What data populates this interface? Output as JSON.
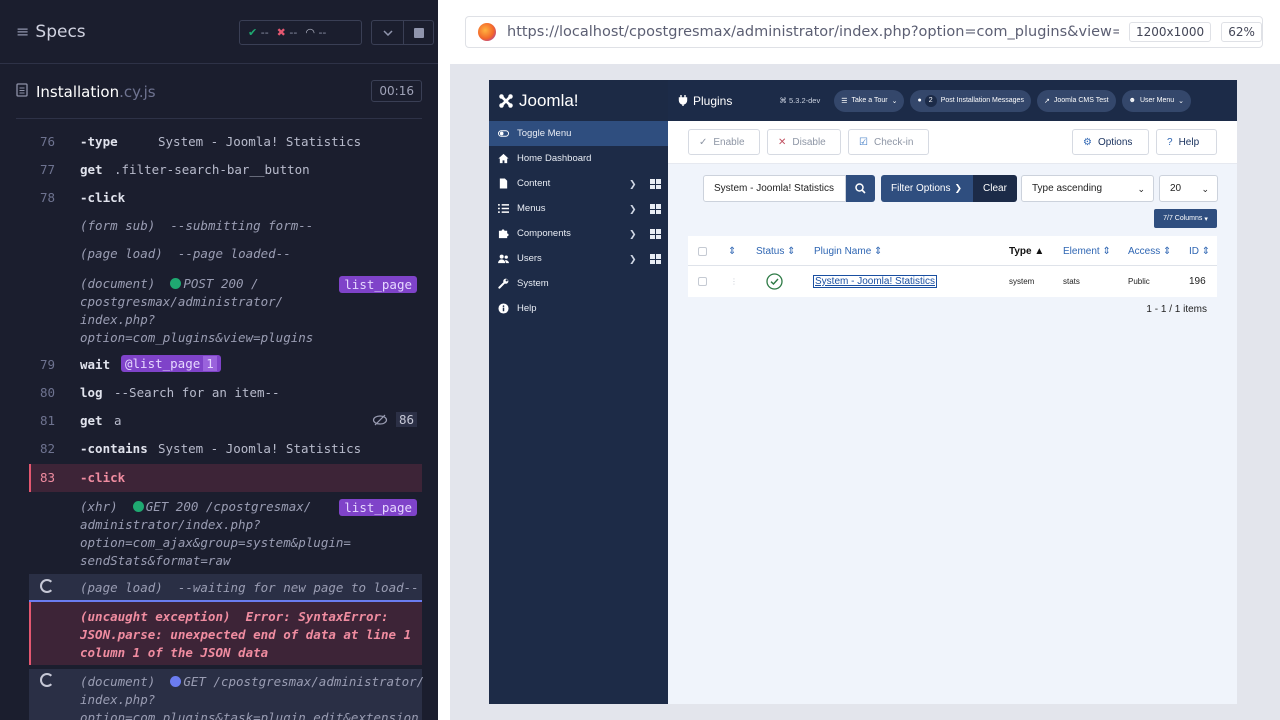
{
  "runner": {
    "specs_title": "Specs",
    "stats": {
      "passed": "--",
      "failed": "--",
      "pending": "--"
    },
    "file_name": "Installation",
    "file_ext": ".cy.js",
    "timer": "00:16",
    "commands": [
      {
        "num": "76",
        "name": "-type",
        "message": "System - Joomla! Statistics"
      },
      {
        "num": "77",
        "name": "get",
        "message": ".filter-search-bar__button"
      },
      {
        "num": "78",
        "name": "-click",
        "message": ""
      },
      {
        "sub": "(form sub)",
        "message": "--submitting form--"
      },
      {
        "sub": "(page load)",
        "message": "--page loaded--"
      },
      {
        "sub": "(document)",
        "status_dot": "#1fa971",
        "method": "POST 200 /",
        "lines": [
          "cpostgresmax/administrator/",
          "index.php?",
          "option=com_plugins&view=plugins"
        ],
        "tag": "list_page"
      },
      {
        "num": "79",
        "name": "wait",
        "alias": "@list_page",
        "alias_count": "1"
      },
      {
        "num": "80",
        "name": "log",
        "message": "--Search for an item--"
      },
      {
        "num": "81",
        "name": "get",
        "message": "a",
        "hidden_count": "86"
      },
      {
        "num": "82",
        "name": "-contains",
        "message": "System - Joomla! Statistics"
      },
      {
        "num": "83",
        "name": "-click",
        "message": ""
      },
      {
        "sub": "(xhr)",
        "status_dot": "#1fa971",
        "method": "GET 200 /cpostgresmax/",
        "lines": [
          "administrator/index.php?",
          "option=com_ajax&group=system&plugin=",
          "sendStats&format=raw"
        ],
        "tag": "list_page"
      },
      {
        "sub": "(page load)",
        "message": "--waiting for new page to load--"
      },
      {
        "sub": "(uncaught exception)",
        "message": "Error: SyntaxError:",
        "lines": [
          "JSON.parse: unexpected end of data at line 1",
          "column 1 of the JSON data"
        ]
      },
      {
        "sub": "(document)",
        "status_dot": "#6b7cf0",
        "method": "GET /cpostgresmax/administrator/",
        "lines": [
          "index.php?",
          "option=com_plugins&task=plugin.edit&extension"
        ]
      }
    ]
  },
  "browser": {
    "url": "https://localhost/cpostgresmax/administrator/index.php?option=com_plugins&view=plugins",
    "viewport": "1200x1000",
    "zoom": "62%"
  },
  "joomla": {
    "brand": "Joomla!",
    "page_title": "Plugins",
    "version": "5.3.2-dev",
    "top_buttons": {
      "tour": "Take a Tour",
      "messages_count": "2",
      "messages": "Post Installation Messages",
      "site": "Joomla CMS Test",
      "user": "User Menu"
    },
    "sidebar": [
      {
        "label": "Toggle Menu"
      },
      {
        "label": "Home Dashboard"
      },
      {
        "label": "Content"
      },
      {
        "label": "Menus"
      },
      {
        "label": "Components"
      },
      {
        "label": "Users"
      },
      {
        "label": "System"
      },
      {
        "label": "Help"
      }
    ],
    "toolbar": {
      "enable": "Enable",
      "disable": "Disable",
      "checkin": "Check-in",
      "options": "Options",
      "help": "Help"
    },
    "filters": {
      "search_value": "System - Joomla! Statistics",
      "filter_options": "Filter Options",
      "clear": "Clear",
      "sort": "Type ascending",
      "limit": "20",
      "columns": "7/7 Columns"
    },
    "table": {
      "headers": {
        "status": "Status",
        "name": "Plugin Name",
        "type": "Type",
        "element": "Element",
        "access": "Access",
        "id": "ID"
      },
      "rows": [
        {
          "name": "System - Joomla! Statistics",
          "type": "system",
          "element": "stats",
          "access": "Public",
          "id": "196"
        }
      ]
    },
    "pagination": "1 - 1 / 1 items"
  }
}
